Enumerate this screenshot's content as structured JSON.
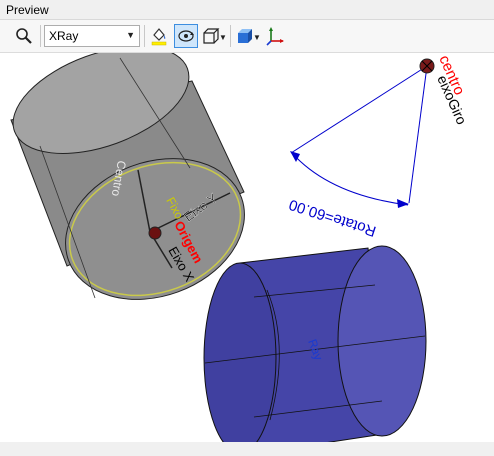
{
  "panel": {
    "title": "Preview"
  },
  "toolbar": {
    "view_mode": {
      "value": "XRay"
    },
    "icons": [
      "zoom-icon",
      "fill-bucket-icon",
      "rotate-view-icon",
      "wireframe-box-icon",
      "shaded-box-icon",
      "axes-icon"
    ]
  },
  "scene": {
    "upper_cylinder": {
      "labels": {
        "eixo_y": "Eixo Y",
        "eixo_x": "Eixo X",
        "centro": "Centro",
        "origem": "Origem",
        "fixo": "Fixo"
      }
    },
    "pivot": {
      "centro": "centro",
      "eixo_giro": "eixoGiro"
    },
    "rotation": {
      "text": "Rotate=60.00"
    },
    "lower_cylinder": {
      "label": "Ray"
    }
  },
  "colors": {
    "accent_red": "#ff0000",
    "dimension_blue": "#0000cc",
    "highlight_yellow": "#cccc00",
    "gray_solid": "#7a7a7a",
    "blue_solid": "#4545a8"
  }
}
